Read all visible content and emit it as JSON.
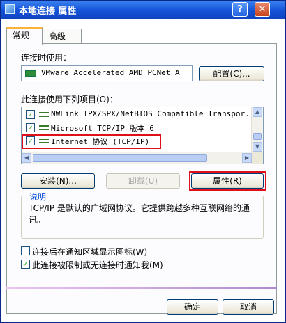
{
  "window": {
    "title": "本地连接 属性",
    "help_label": "?",
    "close_label": "✕"
  },
  "tabs": [
    {
      "label": "常规"
    },
    {
      "label": "高级"
    }
  ],
  "connect_using": {
    "label": "连接时使用：",
    "adapter": "VMware Accelerated AMD PCNet A",
    "configure_button": "配置(C)..."
  },
  "components": {
    "label": "此连接使用下列项目(O)：",
    "items": [
      {
        "text": "NWLink IPX/SPX/NetBIOS Compatible Transpor.",
        "checked": "✓"
      },
      {
        "text": "Microsoft TCP/IP 版本 6",
        "checked": "✓"
      },
      {
        "text": "Internet 协议 (TCP/IP)",
        "checked": "✓"
      }
    ]
  },
  "buttons": {
    "install": "安装(N)...",
    "uninstall": "卸载(U)",
    "properties": "属性(R)"
  },
  "description": {
    "title": "说明",
    "text": "TCP/IP 是默认的广域网协议。它提供跨越多种互联网络的通讯。"
  },
  "options": [
    {
      "label": "连接后在通知区域显示图标(W)",
      "checked": ""
    },
    {
      "label": "此连接被限制或无连接时通知我(M)",
      "checked": "✓"
    }
  ],
  "footer": {
    "ok": "确定",
    "cancel": "取消"
  },
  "colors": {
    "highlight": "#e0101a",
    "titlebar": "#1452d6"
  }
}
